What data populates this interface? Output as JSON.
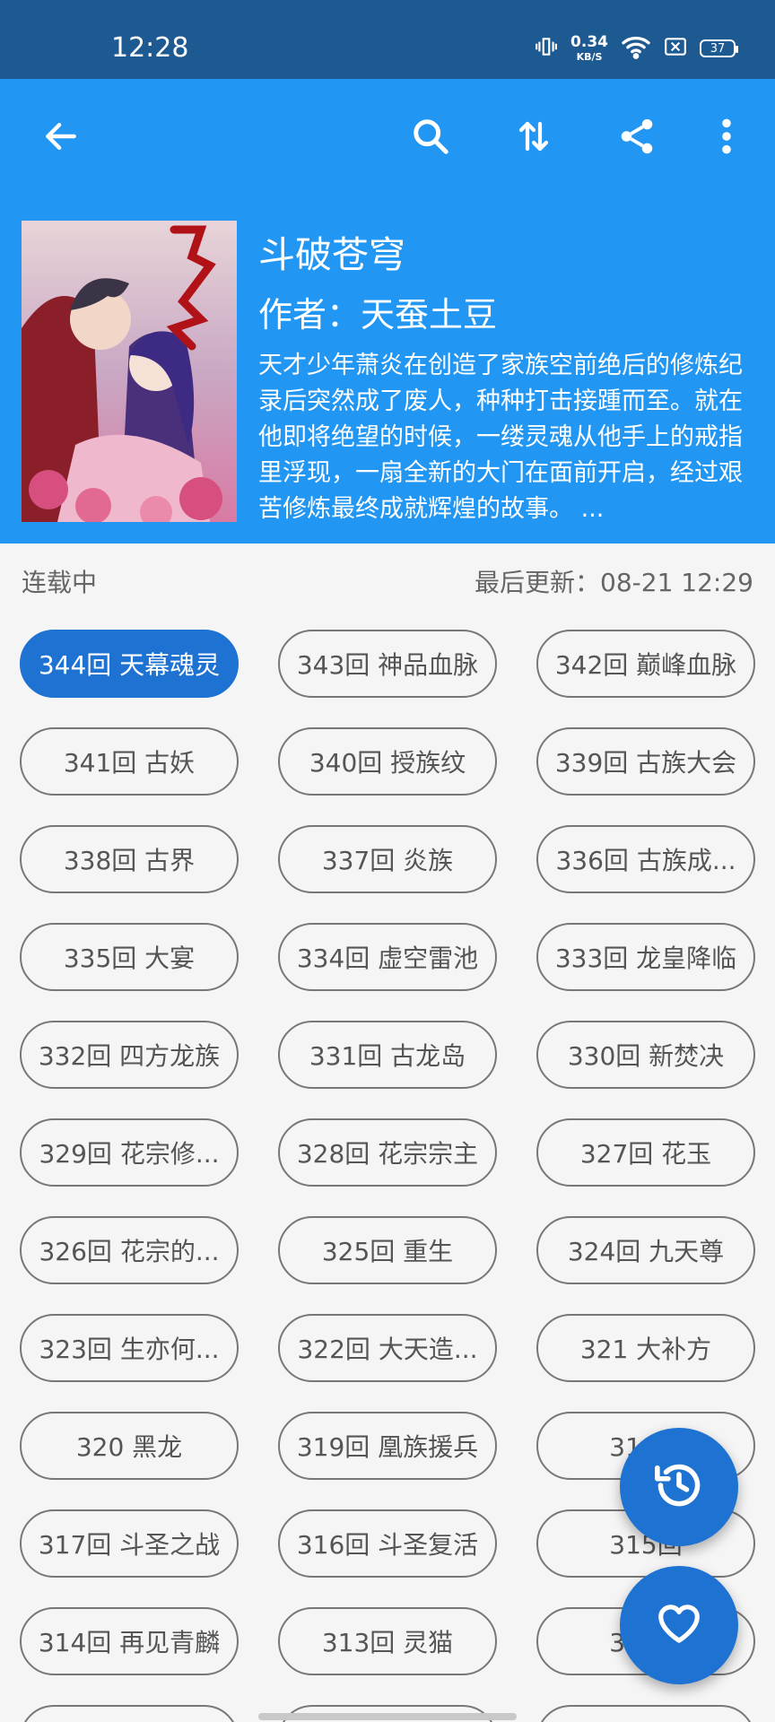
{
  "status_bar": {
    "time": "12:28",
    "net_speed_value": "0.34",
    "net_speed_unit": "KB/S",
    "battery": "37"
  },
  "toolbar": {
    "icons": [
      "back-arrow-icon",
      "search-icon",
      "sort-icon",
      "share-icon",
      "more-vert-icon"
    ]
  },
  "book": {
    "title": "斗破苍穹",
    "author": "作者：天蚕土豆",
    "description": "天才少年萧炎在创造了家族空前绝后的修炼纪录后突然成了废人，种种打击接踵而至。就在他即将绝望的时候，一缕灵魂从他手上的戒指里浮现，一扇全新的大门在面前开启，经过艰苦修炼最终成就辉煌的故事。 ..."
  },
  "info": {
    "status": "连载中",
    "last_update": "最后更新：08-21 12:29"
  },
  "chapters": [
    {
      "label": "344回 天幕魂灵",
      "active": true
    },
    {
      "label": "343回 神品血脉"
    },
    {
      "label": "342回 巅峰血脉"
    },
    {
      "label": "341回 古妖"
    },
    {
      "label": "340回 授族纹"
    },
    {
      "label": "339回 古族大会"
    },
    {
      "label": "338回 古界"
    },
    {
      "label": "337回 炎族"
    },
    {
      "label": "336回 古族成..."
    },
    {
      "label": "335回 大宴"
    },
    {
      "label": "334回 虚空雷池"
    },
    {
      "label": "333回 龙皇降临"
    },
    {
      "label": "332回 四方龙族"
    },
    {
      "label": "331回 古龙岛"
    },
    {
      "label": "330回 新焚决"
    },
    {
      "label": "329回 花宗修..."
    },
    {
      "label": "328回 花宗宗主"
    },
    {
      "label": "327回 花玉"
    },
    {
      "label": "326回 花宗的..."
    },
    {
      "label": "325回 重生"
    },
    {
      "label": "324回 九天尊"
    },
    {
      "label": "323回  生亦何..."
    },
    {
      "label": "322回 大天造..."
    },
    {
      "label": "321 大补方"
    },
    {
      "label": "320 黑龙"
    },
    {
      "label": "319回 凰族援兵"
    },
    {
      "label": "318回"
    },
    {
      "label": "317回  斗圣之战"
    },
    {
      "label": "316回 斗圣复活"
    },
    {
      "label": "315回"
    },
    {
      "label": "314回 再见青麟"
    },
    {
      "label": "313回 灵猫"
    },
    {
      "label": "312回"
    },
    {
      "label": ""
    },
    {
      "label": ""
    },
    {
      "label": ""
    }
  ],
  "fabs": {
    "history_icon": "history-icon",
    "favorite_icon": "heart-outline-icon"
  },
  "colors": {
    "status_bar": "#1e5a92",
    "header": "#2196f3",
    "accent": "#1e73d2"
  }
}
